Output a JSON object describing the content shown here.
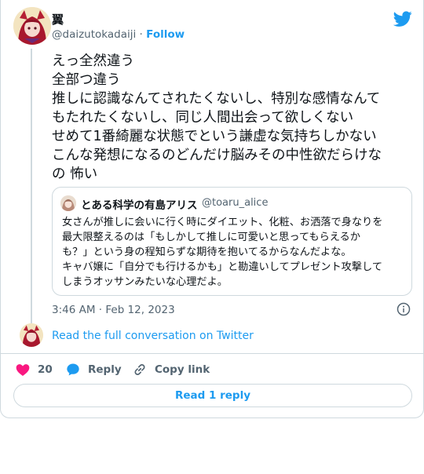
{
  "author": {
    "name": "翼",
    "handle": "@daizutokadaiji",
    "separator": "·",
    "follow_label": "Follow"
  },
  "tweet": {
    "text": "えっ全然違う\n全部つ違う\n推しに認識なんてされたくないし、特別な感情なんて\nもたれたくないし、同じ人間出会って欲しくない\nせめて1番綺麗な状態でという謙虚な気持ちしかない\nこんな発想になるのどんだけ脳みその中性欲だらけな\nの 怖い",
    "timestamp": "3:46 AM · Feb 12, 2023"
  },
  "quote": {
    "name": "とある科学の有島アリス",
    "handle": "@toaru_alice",
    "text": "女さんが推しに会いに行く時にダイエット、化粧、お洒落で身なりを\n最大限整えるのは「もしかして推しに可愛いと思ってもらえるか\nも？」という身の程知らずな期待を抱いてるからなんだよな。\nキャバ嬢に「自分でも行けるかも」と勘違いしてプレゼント攻撃して\nしまうオッサンみたいな心理だよ。"
  },
  "conversation": {
    "read_full_label": "Read the full conversation on Twitter"
  },
  "actions": {
    "like_count": "20",
    "reply_label": "Reply",
    "copy_link_label": "Copy link"
  },
  "read_replies_label": "Read 1 reply",
  "colors": {
    "accent": "#1d9bf0",
    "like": "#f91880",
    "muted": "#536471",
    "border": "#cfd9de"
  },
  "icons": [
    "twitter-bird-icon",
    "info-icon",
    "heart-icon",
    "reply-bubble-icon",
    "link-icon"
  ]
}
